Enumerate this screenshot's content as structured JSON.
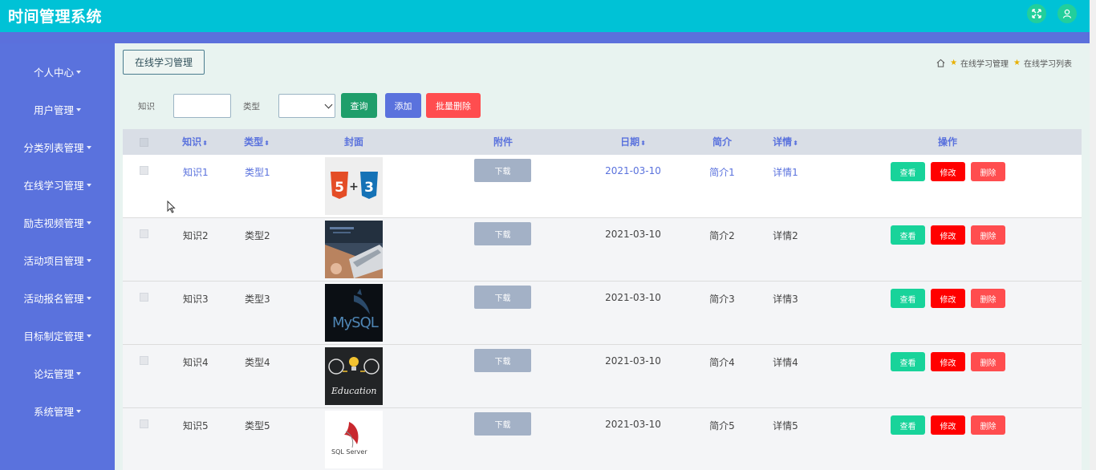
{
  "header": {
    "title": "时间管理系统",
    "icons": [
      "fullscreen-icon",
      "user-icon"
    ]
  },
  "sidebar": {
    "items": [
      {
        "label": "个人中心"
      },
      {
        "label": "用户管理"
      },
      {
        "label": "分类列表管理"
      },
      {
        "label": "在线学习管理"
      },
      {
        "label": "励志视频管理"
      },
      {
        "label": "活动项目管理"
      },
      {
        "label": "活动报名管理"
      },
      {
        "label": "目标制定管理"
      },
      {
        "label": "论坛管理"
      },
      {
        "label": "系统管理"
      }
    ]
  },
  "page": {
    "section_label": "在线学习管理",
    "breadcrumb": [
      "在线学习管理",
      "在线学习列表"
    ]
  },
  "search": {
    "knowledge_label": "知识",
    "knowledge_value": "",
    "type_label": "类型",
    "type_value": "",
    "query_label": "查询",
    "add_label": "添加",
    "batch_delete_label": "批量删除"
  },
  "table": {
    "columns": {
      "knowledge": "知识",
      "type": "类型",
      "cover": "封面",
      "attachment": "附件",
      "date": "日期",
      "summary": "简介",
      "detail": "详情",
      "actions": "操作"
    },
    "sort_glyph": "⬍",
    "download_label": "下载",
    "view_label": "查看",
    "edit_label": "修改",
    "delete_label": "删除",
    "rows": [
      {
        "knowledge": "知识1",
        "type": "类型1",
        "cover": "html5-css3",
        "date": "2021-03-10",
        "summary": "简介1",
        "detail": "详情1",
        "highlight": true
      },
      {
        "knowledge": "知识2",
        "type": "类型2",
        "cover": "laptop-photo",
        "date": "2021-03-10",
        "summary": "简介2",
        "detail": "详情2",
        "highlight": false
      },
      {
        "knowledge": "知识3",
        "type": "类型3",
        "cover": "mysql",
        "date": "2021-03-10",
        "summary": "简介3",
        "detail": "详情3",
        "highlight": false
      },
      {
        "knowledge": "知识4",
        "type": "类型4",
        "cover": "education",
        "date": "2021-03-10",
        "summary": "简介4",
        "detail": "详情4",
        "highlight": false
      },
      {
        "knowledge": "知识5",
        "type": "类型5",
        "cover": "sql-server",
        "date": "2021-03-10",
        "summary": "简介5",
        "detail": "详情5",
        "highlight": false
      }
    ]
  },
  "cover_text": {
    "mysql": "MySQL",
    "education": "Education",
    "sql_server": "SQL Server"
  },
  "colors": {
    "header": "#00c2d6",
    "sidebar": "#5a72dd",
    "query": "#1f9e6b",
    "add": "#5a72dd",
    "batch_delete": "#ff4d4f",
    "view": "#18d39a",
    "edit": "#ff0000",
    "delete": "#ff4d4f",
    "download": "#a3b1c6"
  }
}
